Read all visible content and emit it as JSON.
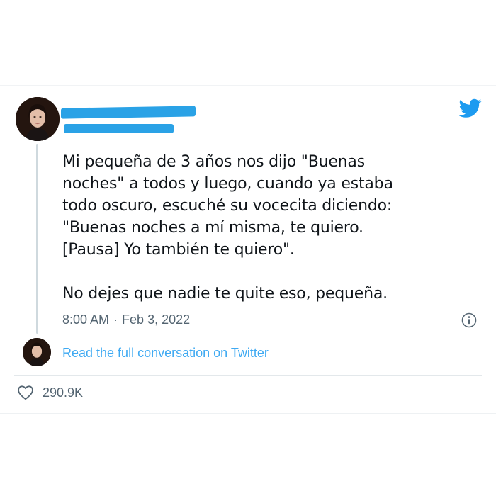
{
  "tweet": {
    "text_lines": [
      "Mi pequeña de 3 años nos dijo \"Buenas",
      "noches\" a todos y luego, cuando ya estaba",
      "todo oscuro, escuché su vocecita diciendo:",
      "\"Buenas noches a mí misma, te quiero.",
      "[Pausa] Yo también te quiero\".",
      "No dejes que nadie te quite eso, pequeña."
    ],
    "time": "8:00 AM",
    "separator": "·",
    "date": "Feb 3, 2022"
  },
  "conversation_link": "Read the full conversation on Twitter",
  "likes_count": "290.9K",
  "colors": {
    "accent": "#1d9bf0",
    "redaction": "#2aa2e6",
    "text": "#0f1419",
    "muted": "#536471"
  },
  "icons": {
    "brand": "twitter-bird-icon",
    "info": "info-icon",
    "like": "heart-icon"
  }
}
